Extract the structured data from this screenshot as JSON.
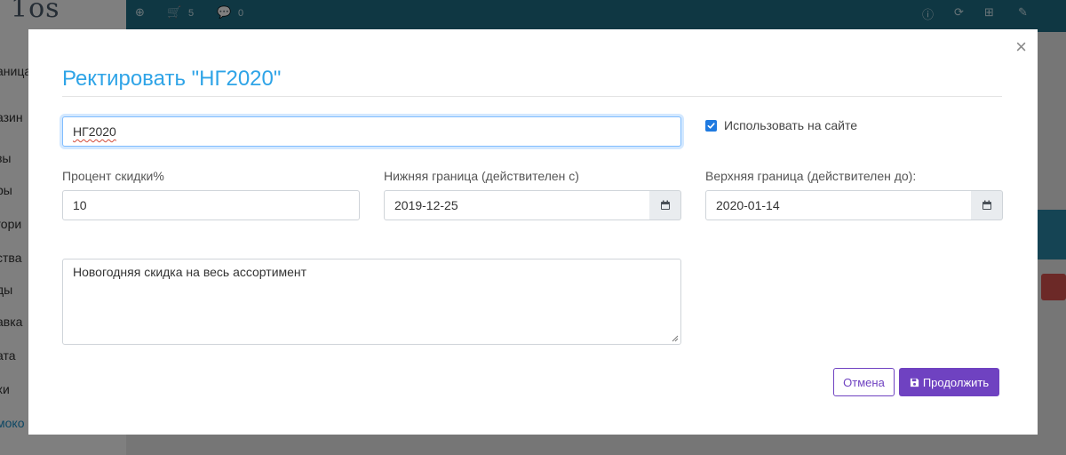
{
  "background": {
    "logo": "1os",
    "topbar": {
      "cart_count": "5",
      "chat_count": "0"
    },
    "sidebar_fragments": [
      "аница",
      "азин",
      "зы",
      "ры",
      "гори",
      "ства",
      "ды",
      "авка",
      "ата",
      "хи",
      "моко"
    ]
  },
  "modal": {
    "title": "Ректировать \"НГ2020\"",
    "name_value": "НГ2020",
    "use_on_site_label": "Использовать на сайте",
    "use_on_site_checked": true,
    "discount": {
      "label": "Процент скидки%",
      "value": "10"
    },
    "lower_bound": {
      "label": "Нижняя граница (действителен с)",
      "value": "2019-12-25"
    },
    "upper_bound": {
      "label": "Верхняя граница (действителен до):",
      "value": "2020-01-14"
    },
    "description": "Новогодняя скидка на весь ассортимент",
    "cancel_label": "Отмена",
    "continue_label": "Продолжить"
  },
  "colors": {
    "accent": "#6f42c1",
    "title": "#2fa4e7",
    "checkbox": "#1f7ae0"
  }
}
